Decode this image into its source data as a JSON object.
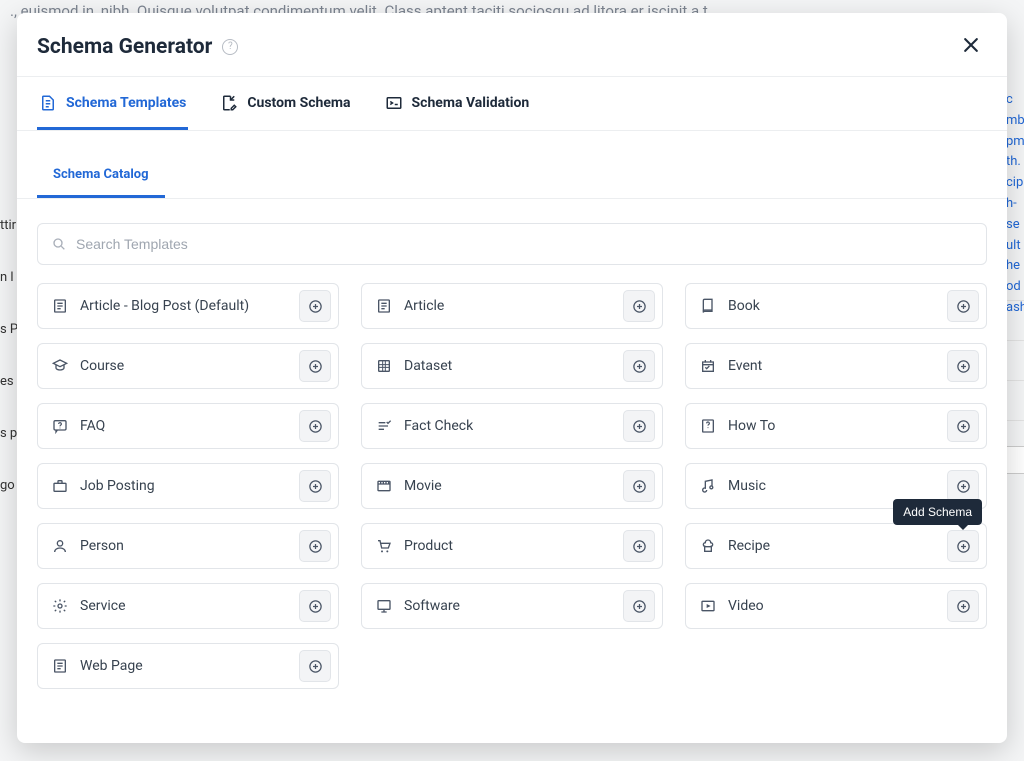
{
  "background": {
    "top_text": "., euismod in, nibh. Quisque volutpat condimentum velit. Class aptent taciti sociosqu ad litora er iscipit a t",
    "right_fragments": [
      "c",
      "mb",
      "pm",
      "th.",
      "cip",
      "h-",
      "se",
      "ult",
      "he",
      "od",
      "ash"
    ],
    "left_fragments": [
      "ttir",
      "n l",
      "s P",
      "es",
      "s p",
      "go"
    ],
    "red_fragment": "ash"
  },
  "modal": {
    "title": "Schema Generator",
    "tabs": [
      {
        "label": "Schema Templates",
        "icon": "file-icon",
        "active": true
      },
      {
        "label": "Custom Schema",
        "icon": "file-edit-icon",
        "active": false
      },
      {
        "label": "Schema Validation",
        "icon": "terminal-box-icon",
        "active": false
      }
    ],
    "sub_tab": "Schema Catalog",
    "search": {
      "placeholder": "Search Templates"
    },
    "tooltip": "Add Schema",
    "templates": [
      {
        "label": "Article - Blog Post (Default)",
        "icon": "article"
      },
      {
        "label": "Article",
        "icon": "article"
      },
      {
        "label": "Book",
        "icon": "book"
      },
      {
        "label": "Course",
        "icon": "grad"
      },
      {
        "label": "Dataset",
        "icon": "grid"
      },
      {
        "label": "Event",
        "icon": "event"
      },
      {
        "label": "FAQ",
        "icon": "faq"
      },
      {
        "label": "Fact Check",
        "icon": "fact"
      },
      {
        "label": "How To",
        "icon": "howto"
      },
      {
        "label": "Job Posting",
        "icon": "briefcase"
      },
      {
        "label": "Movie",
        "icon": "movie"
      },
      {
        "label": "Music",
        "icon": "music"
      },
      {
        "label": "Person",
        "icon": "person"
      },
      {
        "label": "Product",
        "icon": "cart"
      },
      {
        "label": "Recipe",
        "icon": "recipe"
      },
      {
        "label": "Service",
        "icon": "service"
      },
      {
        "label": "Software",
        "icon": "software"
      },
      {
        "label": "Video",
        "icon": "video"
      },
      {
        "label": "Web Page",
        "icon": "article"
      }
    ]
  }
}
